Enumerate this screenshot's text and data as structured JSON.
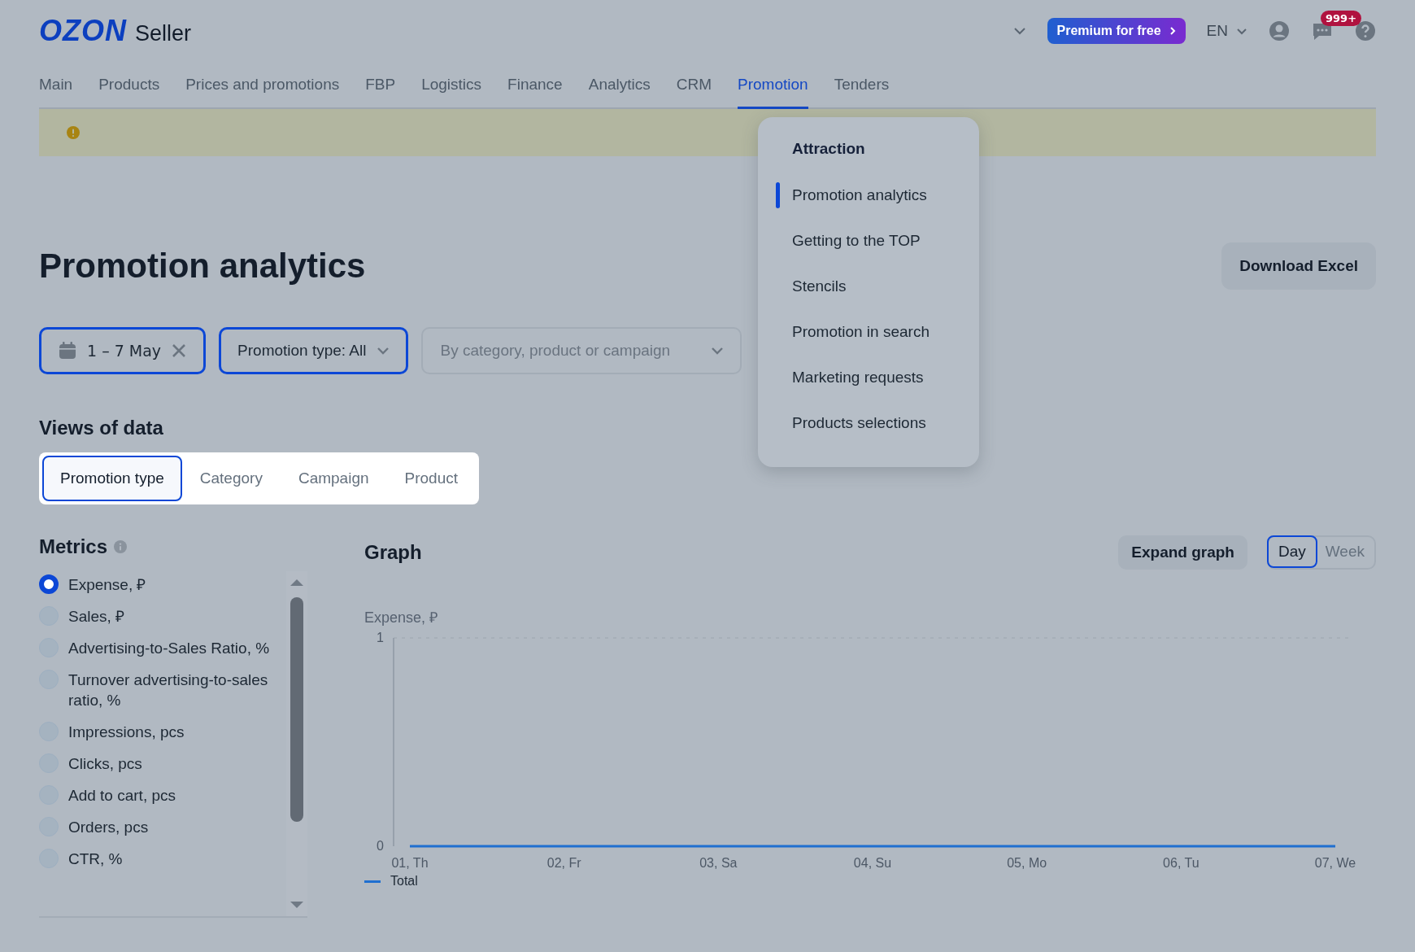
{
  "header": {
    "logo": "OZON",
    "logo_suffix": "Seller",
    "premium_button": "Premium for free",
    "language": "EN",
    "notifications_badge": "999+"
  },
  "nav": [
    {
      "label": "Main",
      "selected": false
    },
    {
      "label": "Products",
      "selected": false
    },
    {
      "label": "Prices and promotions",
      "selected": false
    },
    {
      "label": "FBP",
      "selected": false
    },
    {
      "label": "Logistics",
      "selected": false
    },
    {
      "label": "Finance",
      "selected": false
    },
    {
      "label": "Analytics",
      "selected": false
    },
    {
      "label": "CRM",
      "selected": false
    },
    {
      "label": "Promotion",
      "selected": true
    },
    {
      "label": "Tenders",
      "selected": false
    }
  ],
  "dropdown_menu": {
    "heading": "Attraction",
    "items": [
      {
        "label": "Promotion analytics",
        "selected": true
      },
      {
        "label": "Getting to the TOP",
        "selected": false
      },
      {
        "label": "Stencils",
        "selected": false
      },
      {
        "label": "Promotion in search",
        "selected": false
      },
      {
        "label": "Marketing requests",
        "selected": false
      },
      {
        "label": "Products selections",
        "selected": false
      }
    ]
  },
  "page_title": "Promotion analytics",
  "download_button": "Download Excel",
  "filters": {
    "date": "1 – 7 May",
    "promotion_type": "Promotion type: All",
    "search_placeholder": "By category, product or campaign"
  },
  "views": {
    "heading": "Views of data",
    "tabs": [
      {
        "label": "Promotion type",
        "selected": true
      },
      {
        "label": "Category",
        "selected": false
      },
      {
        "label": "Campaign",
        "selected": false
      },
      {
        "label": "Product",
        "selected": false
      }
    ]
  },
  "metrics": {
    "heading": "Metrics",
    "items": [
      {
        "label": "Expense, ₽",
        "selected": true
      },
      {
        "label": "Sales, ₽",
        "selected": false
      },
      {
        "label": "Advertising-to-Sales Ratio, %",
        "selected": false
      },
      {
        "label": "Turnover advertising-to-sales ratio, %",
        "selected": false
      },
      {
        "label": "Impressions, pcs",
        "selected": false
      },
      {
        "label": "Clicks, pcs",
        "selected": false
      },
      {
        "label": "Add to cart, pcs",
        "selected": false
      },
      {
        "label": "Orders, pcs",
        "selected": false
      },
      {
        "label": "CTR, %",
        "selected": false
      }
    ]
  },
  "graph": {
    "heading": "Graph",
    "expand_button": "Expand graph",
    "periods": [
      {
        "label": "Day",
        "selected": true
      },
      {
        "label": "Week",
        "selected": false
      }
    ],
    "chart_data": {
      "type": "line",
      "ylabel": "Expense, ₽",
      "categories": [
        "01, Th",
        "02, Fr",
        "03, Sa",
        "04, Su",
        "05, Mo",
        "06, Tu",
        "07, We"
      ],
      "ylim": [
        0,
        1
      ],
      "yticks": [
        0,
        1
      ],
      "series": [
        {
          "name": "Total",
          "color": "#1f6fd0",
          "values": [
            0,
            0,
            0,
            0,
            0,
            0,
            0
          ]
        }
      ]
    }
  }
}
